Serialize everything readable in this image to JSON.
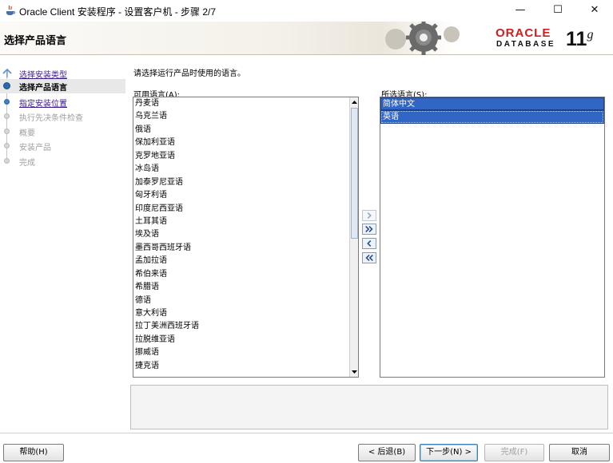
{
  "window": {
    "title": "Oracle Client 安装程序 - 设置客户机 - 步骤 2/7",
    "min_glyph": "—",
    "max_glyph": "☐",
    "close_glyph": "✕"
  },
  "header": {
    "page_title": "选择产品语言",
    "brand_oracle": "ORACLE",
    "brand_database": "DATABASE",
    "brand_version": "11",
    "brand_version_sup": "g"
  },
  "steps": [
    {
      "label": "选择安装类型",
      "state": "done"
    },
    {
      "label": "选择产品语言",
      "state": "current"
    },
    {
      "label": "指定安装位置",
      "state": "done"
    },
    {
      "label": "执行先决条件检查",
      "state": "pending"
    },
    {
      "label": "概要",
      "state": "pending"
    },
    {
      "label": "安装产品",
      "state": "pending"
    },
    {
      "label": "完成",
      "state": "pending"
    }
  ],
  "content": {
    "instruction": "请选择运行产品时使用的语言。",
    "available_label": "可用语言(",
    "available_mnemonic": "A",
    "available_label_end": "):",
    "selected_label": "所选语言(",
    "selected_mnemonic": "S",
    "selected_label_end": "):"
  },
  "available_languages": [
    "丹麦语",
    "乌克兰语",
    "俄语",
    "保加利亚语",
    "克罗地亚语",
    "冰岛语",
    "加泰罗尼亚语",
    "匈牙利语",
    "印度尼西亚语",
    "土耳其语",
    "埃及语",
    "墨西哥西班牙语",
    "孟加拉语",
    "希伯来语",
    "希腊语",
    "德语",
    "意大利语",
    "拉丁美洲西班牙语",
    "拉脱维亚语",
    "挪威语",
    "捷克语"
  ],
  "selected_languages": [
    {
      "label": "简体中文",
      "focused": false
    },
    {
      "label": "英语",
      "focused": true
    }
  ],
  "buttons": {
    "help": "帮助(H)",
    "back": "< 后退(B)",
    "next": "下一步(N) >",
    "finish": "完成(F)",
    "cancel": "取消"
  },
  "colors": {
    "selection": "#3266c4",
    "oracle_red": "#cc1f1f",
    "link": "#3a1a8c",
    "step_done": "#3b82c4"
  }
}
